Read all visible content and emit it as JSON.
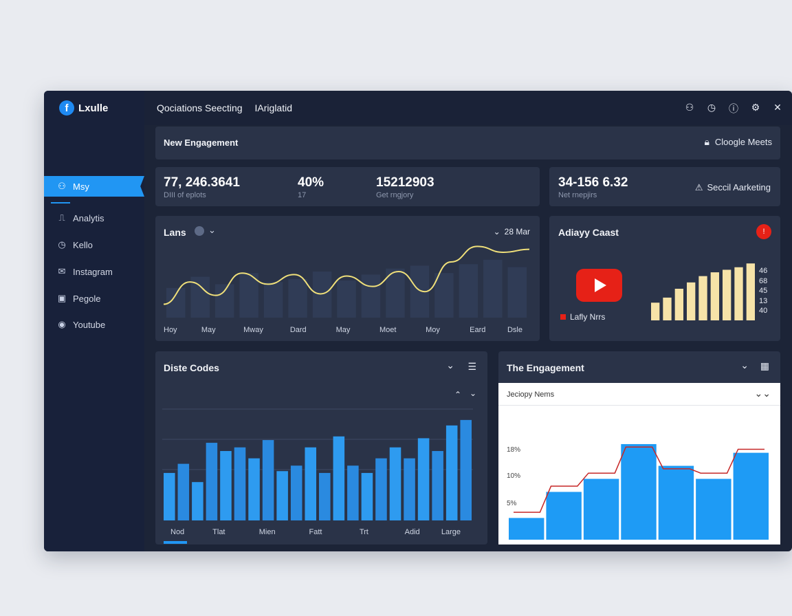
{
  "app": {
    "name": "Lxulle"
  },
  "topbar": {
    "title1": "Qociations Seecting",
    "title2": "IAriglatid"
  },
  "sidebar": {
    "items": [
      {
        "label": "Msy",
        "icon": "user-icon"
      },
      {
        "label": "Analytis",
        "icon": "chart-icon"
      },
      {
        "label": "Kello",
        "icon": "clock-icon"
      },
      {
        "label": "Instagram",
        "icon": "mail-icon"
      },
      {
        "label": "Pegole",
        "icon": "calendar-icon"
      },
      {
        "label": "Youtube",
        "icon": "circle-icon"
      }
    ]
  },
  "header_panel": {
    "title": "New Engagement",
    "action": "Cloogle Meets"
  },
  "stats": {
    "s1_value": "77, 246.3641",
    "s1_label": "DIII of eplots",
    "s2_value": "40%",
    "s2_label": "17",
    "s3_value": "15212903",
    "s3_label": "Get rngjory",
    "s4_value": "34-156 6.32",
    "s4_label": "Net rnepjirs",
    "s4_action": "Seccil Aarketing"
  },
  "line_panel": {
    "title": "Lans",
    "range": "28 Mar",
    "x_labels": [
      "Hoy",
      "May",
      "Mway",
      "Dard",
      "May",
      "Moet",
      "Moy",
      "Eard",
      "Dsle"
    ]
  },
  "youtube_panel": {
    "title": "Adiayy Caast",
    "legend": "Lafly Nrrs",
    "value_labels": [
      "46",
      "68",
      "45",
      "13",
      "40"
    ]
  },
  "bar_panel": {
    "title": "Diste Codes",
    "x_labels": [
      "Nod",
      "Tlat",
      "Mien",
      "Fatt",
      "Trt",
      "Adid",
      "Large"
    ]
  },
  "engage_panel": {
    "title": "The Engagement",
    "subtitle": "Jeciopy Nems",
    "y_labels": [
      "18%",
      "10%",
      "5%"
    ]
  },
  "colors": {
    "accent": "#2196f3",
    "line": "#f0e07a",
    "cream": "#f6e3a8",
    "youtube": "#e62117",
    "trend": "#c62828"
  },
  "chart_data": [
    {
      "type": "line",
      "title": "Lans",
      "x": [
        "Hoy",
        "May",
        "Mway",
        "Dard",
        "May",
        "Moet",
        "Moy",
        "Eard",
        "Dsle"
      ],
      "series": [
        {
          "values": [
            18,
            48,
            30,
            60,
            45,
            58,
            32,
            56,
            42,
            62,
            35,
            75,
            96,
            88,
            92
          ]
        }
      ],
      "background_bars": [
        40,
        55,
        45,
        60,
        48,
        52,
        62,
        50,
        58,
        66,
        70,
        60,
        72,
        78,
        68
      ],
      "ylim": [
        0,
        100
      ]
    },
    {
      "type": "bar",
      "title": "Adiayy Caast",
      "values": [
        28,
        36,
        50,
        60,
        70,
        76,
        80,
        84,
        90
      ],
      "ylim": [
        0,
        100
      ]
    },
    {
      "type": "bar",
      "title": "Diste Codes",
      "categories": [
        "Nod",
        "Tlat",
        "Mien",
        "Fatt",
        "Trt",
        "Adid",
        "Large"
      ],
      "values": [
        52,
        62,
        42,
        85,
        76,
        80,
        68,
        88,
        54,
        60,
        80,
        52,
        92,
        60,
        52,
        68,
        80,
        68,
        90,
        76,
        104,
        110
      ],
      "ylim": [
        0,
        140
      ]
    },
    {
      "type": "bar",
      "title": "The Engagement",
      "values": [
        5,
        11,
        14,
        22,
        17,
        14,
        20
      ],
      "trend": [
        6,
        12,
        15,
        21,
        16,
        15,
        20.5
      ],
      "ylim": [
        0,
        25
      ]
    }
  ]
}
